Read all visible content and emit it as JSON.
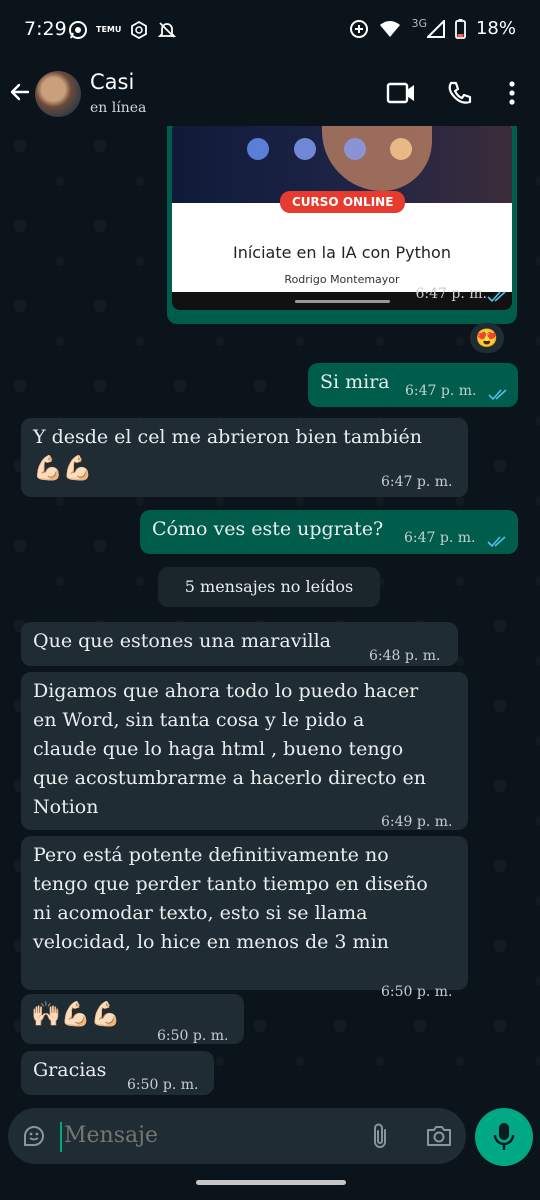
{
  "status_bar": {
    "time": "7:29",
    "temu_label": "TEMU",
    "network": "3G",
    "battery": "18%"
  },
  "header": {
    "contact_name": "Casi",
    "contact_status": "en línea"
  },
  "image_message": {
    "badge": "CURSO ONLINE",
    "title": "Iníciate en la IA con Python",
    "author": "Rodrigo Montemayor",
    "time": "6:47 p. m."
  },
  "reaction": "😍",
  "messages": [
    {
      "text": "Si mira",
      "time": "6:47 p. m."
    },
    {
      "text": "Y desde el cel me abrieron bien también",
      "emoji": "💪🏻💪🏻",
      "time": "6:47 p. m."
    },
    {
      "text": "Cómo ves este upgrate?",
      "time": "6:47 p. m."
    },
    {
      "text": "Que que estones una maravilla",
      "time": "6:48 p. m."
    },
    {
      "lines": [
        "Digamos que ahora todo lo puedo hacer",
        "en Word, sin tanta cosa y le pido a",
        "claude que lo haga html ,  bueno tengo",
        "que acostumbrarme a hacerlo directo en",
        "Notion"
      ],
      "time": "6:49 p. m."
    },
    {
      "lines": [
        "Pero está potente definitivamente no",
        "tengo que perder tanto tiempo en diseño",
        "ni acomodar texto, esto si se llama",
        "velocidad, lo hice en menos de 3 min"
      ],
      "time": "6:50 p. m."
    },
    {
      "emoji": "🙌🏻💪🏻💪🏻",
      "time": "6:50 p. m."
    },
    {
      "text": "Gracias",
      "time": "6:50 p. m."
    }
  ],
  "unread_divider": "5 mensajes no leídos",
  "composer": {
    "placeholder": "Mensaje"
  },
  "colors": {
    "outgoing": "#005c4b",
    "incoming": "#202c33",
    "accent": "#00a884",
    "read_ticks": "#53bdeb"
  }
}
